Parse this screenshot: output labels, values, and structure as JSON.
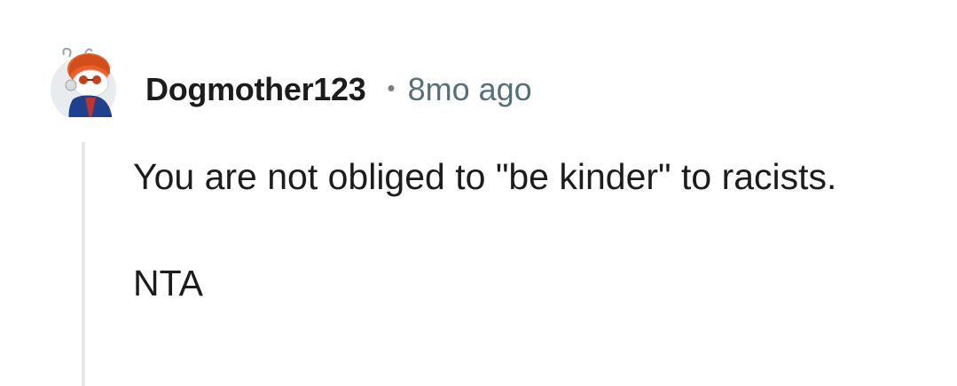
{
  "comment": {
    "author": "Dogmother123",
    "separator": "•",
    "timestamp": "8mo ago",
    "avatar_icon": "snoo-avatar-icon",
    "paragraphs": [
      "You are not obliged to \"be kinder\" to racists.",
      "NTA"
    ]
  }
}
